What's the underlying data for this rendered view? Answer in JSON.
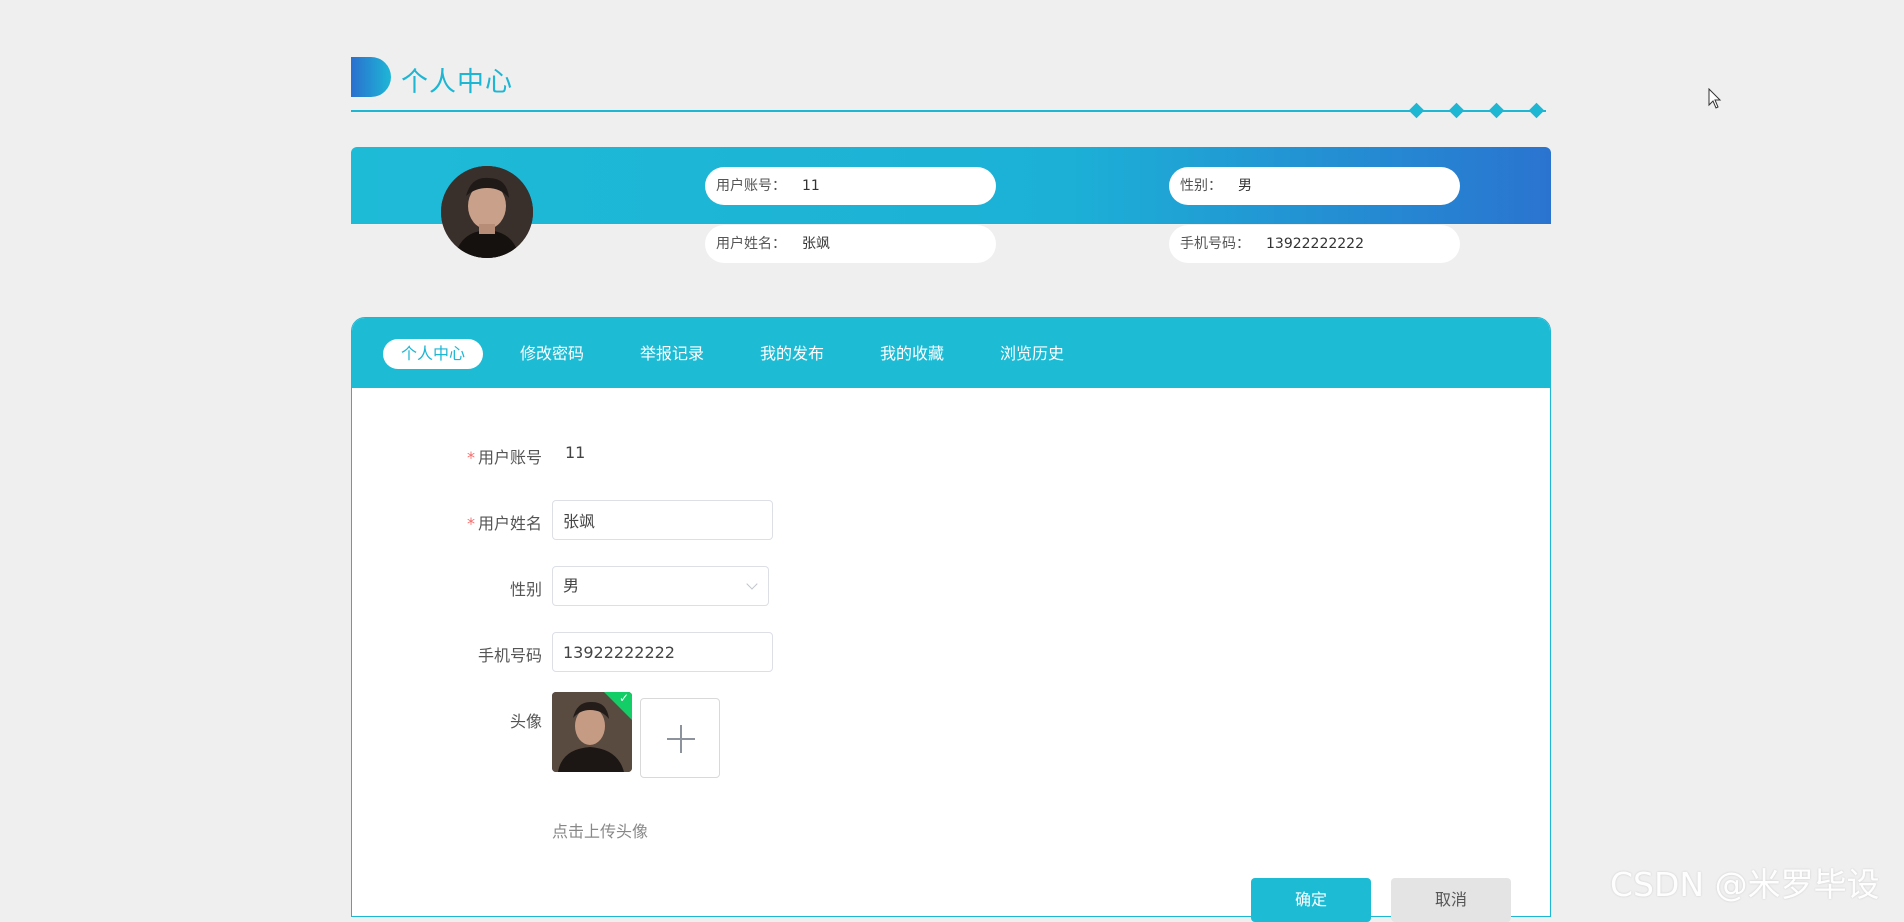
{
  "page": {
    "title": "个人中心"
  },
  "profile": {
    "account_label": "用户账号：",
    "account_value": "11",
    "gender_label": "性别：",
    "gender_value": "男",
    "name_label": "用户姓名：",
    "name_value": "张飒",
    "phone_label": "手机号码：",
    "phone_value": "13922222222"
  },
  "tabs": [
    {
      "label": "个人中心",
      "active": true
    },
    {
      "label": "修改密码"
    },
    {
      "label": "举报记录"
    },
    {
      "label": "我的发布"
    },
    {
      "label": "我的收藏"
    },
    {
      "label": "浏览历史"
    }
  ],
  "form": {
    "account_label": "用户账号",
    "account_value": "11",
    "name_label": "用户姓名",
    "name_value": "张飒",
    "gender_label": "性别",
    "gender_value": "男",
    "phone_label": "手机号码",
    "phone_value": "13922222222",
    "avatar_label": "头像",
    "upload_tip": "点击上传头像",
    "required_mark": "*"
  },
  "buttons": {
    "confirm": "确定",
    "cancel": "取消"
  },
  "watermark": "CSDN @米罗毕设",
  "colors": {
    "accent": "#1db6d3",
    "band_end": "#2a74d0",
    "required": "#f56c6c",
    "success": "#13ce66"
  }
}
